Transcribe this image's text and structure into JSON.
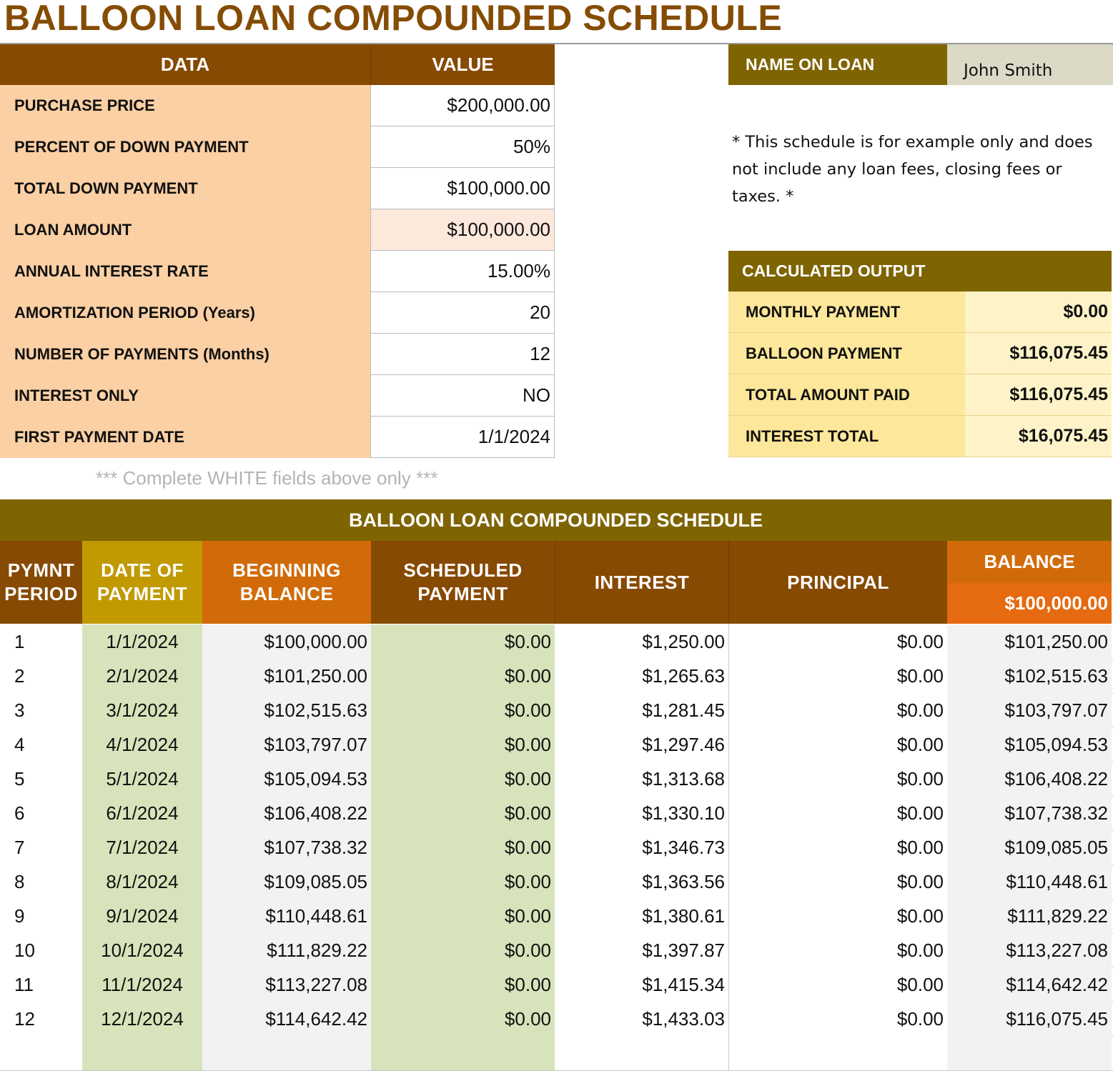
{
  "page_title": "BALLOON LOAN COMPOUNDED SCHEDULE",
  "inputs": {
    "col_data": "DATA",
    "col_value": "VALUE",
    "rows": [
      {
        "label": "PURCHASE PRICE",
        "value": "$200,000.00"
      },
      {
        "label": "PERCENT OF DOWN PAYMENT",
        "value": "50%"
      },
      {
        "label": "TOTAL DOWN PAYMENT",
        "value": "$100,000.00"
      },
      {
        "label": "LOAN AMOUNT",
        "value": "$100,000.00"
      },
      {
        "label": "ANNUAL INTEREST RATE",
        "value": "15.00%"
      },
      {
        "label": "AMORTIZATION PERIOD (Years)",
        "value": "20"
      },
      {
        "label": "NUMBER OF PAYMENTS (Months)",
        "value": "12"
      },
      {
        "label": "INTEREST ONLY",
        "value": "NO"
      },
      {
        "label": "FIRST PAYMENT DATE",
        "value": "1/1/2024"
      }
    ],
    "hint": "*** Complete WHITE fields above only ***"
  },
  "name_on_loan": {
    "label": "NAME ON LOAN",
    "value": "John Smith"
  },
  "note": "* This schedule is for example only and does not include any loan fees, closing fees or taxes. *",
  "output": {
    "title": "CALCULATED OUTPUT",
    "rows": [
      {
        "label": "MONTHLY PAYMENT",
        "value": "$0.00"
      },
      {
        "label": "BALLOON PAYMENT",
        "value": "$116,075.45"
      },
      {
        "label": "TOTAL AMOUNT PAID",
        "value": "$116,075.45"
      },
      {
        "label": "INTEREST TOTAL",
        "value": "$16,075.45"
      }
    ]
  },
  "schedule": {
    "title": "BALLOON LOAN COMPOUNDED SCHEDULE",
    "headers": {
      "period": "PYMNT PERIOD",
      "date": "DATE OF PAYMENT",
      "beginning": "BEGINNING BALANCE",
      "scheduled": "SCHEDULED PAYMENT",
      "interest": "INTEREST",
      "principal": "PRINCIPAL",
      "balance": "BALANCE"
    },
    "starting_balance": "$100,000.00",
    "rows": [
      {
        "period": "1",
        "date": "1/1/2024",
        "beginning": "$100,000.00",
        "scheduled": "$0.00",
        "interest": "$1,250.00",
        "principal": "$0.00",
        "balance": "$101,250.00"
      },
      {
        "period": "2",
        "date": "2/1/2024",
        "beginning": "$101,250.00",
        "scheduled": "$0.00",
        "interest": "$1,265.63",
        "principal": "$0.00",
        "balance": "$102,515.63"
      },
      {
        "period": "3",
        "date": "3/1/2024",
        "beginning": "$102,515.63",
        "scheduled": "$0.00",
        "interest": "$1,281.45",
        "principal": "$0.00",
        "balance": "$103,797.07"
      },
      {
        "period": "4",
        "date": "4/1/2024",
        "beginning": "$103,797.07",
        "scheduled": "$0.00",
        "interest": "$1,297.46",
        "principal": "$0.00",
        "balance": "$105,094.53"
      },
      {
        "period": "5",
        "date": "5/1/2024",
        "beginning": "$105,094.53",
        "scheduled": "$0.00",
        "interest": "$1,313.68",
        "principal": "$0.00",
        "balance": "$106,408.22"
      },
      {
        "period": "6",
        "date": "6/1/2024",
        "beginning": "$106,408.22",
        "scheduled": "$0.00",
        "interest": "$1,330.10",
        "principal": "$0.00",
        "balance": "$107,738.32"
      },
      {
        "period": "7",
        "date": "7/1/2024",
        "beginning": "$107,738.32",
        "scheduled": "$0.00",
        "interest": "$1,346.73",
        "principal": "$0.00",
        "balance": "$109,085.05"
      },
      {
        "period": "8",
        "date": "8/1/2024",
        "beginning": "$109,085.05",
        "scheduled": "$0.00",
        "interest": "$1,363.56",
        "principal": "$0.00",
        "balance": "$110,448.61"
      },
      {
        "period": "9",
        "date": "9/1/2024",
        "beginning": "$110,448.61",
        "scheduled": "$0.00",
        "interest": "$1,380.61",
        "principal": "$0.00",
        "balance": "$111,829.22"
      },
      {
        "period": "10",
        "date": "10/1/2024",
        "beginning": "$111,829.22",
        "scheduled": "$0.00",
        "interest": "$1,397.87",
        "principal": "$0.00",
        "balance": "$113,227.08"
      },
      {
        "period": "11",
        "date": "11/1/2024",
        "beginning": "$113,227.08",
        "scheduled": "$0.00",
        "interest": "$1,415.34",
        "principal": "$0.00",
        "balance": "$114,642.42"
      },
      {
        "period": "12",
        "date": "12/1/2024",
        "beginning": "$114,642.42",
        "scheduled": "$0.00",
        "interest": "$1,433.03",
        "principal": "$0.00",
        "balance": "$116,075.45"
      }
    ]
  }
}
